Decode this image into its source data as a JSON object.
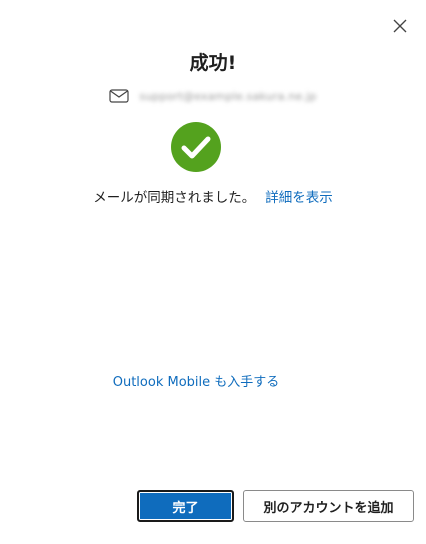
{
  "dialog": {
    "title": "成功!",
    "account_email": "support@example.sakura.ne.jp",
    "sync_message": "メールが同期されました。",
    "details_link": "詳細を表示",
    "mobile_link": "Outlook Mobile も入手する",
    "done_button": "完了",
    "add_account_button": "別のアカウントを追加"
  },
  "icons": {
    "close": "close-icon",
    "mail": "mail-icon",
    "success": "checkmark-circle-icon"
  },
  "colors": {
    "accent": "#0f6cbd",
    "success": "#54a21e"
  }
}
